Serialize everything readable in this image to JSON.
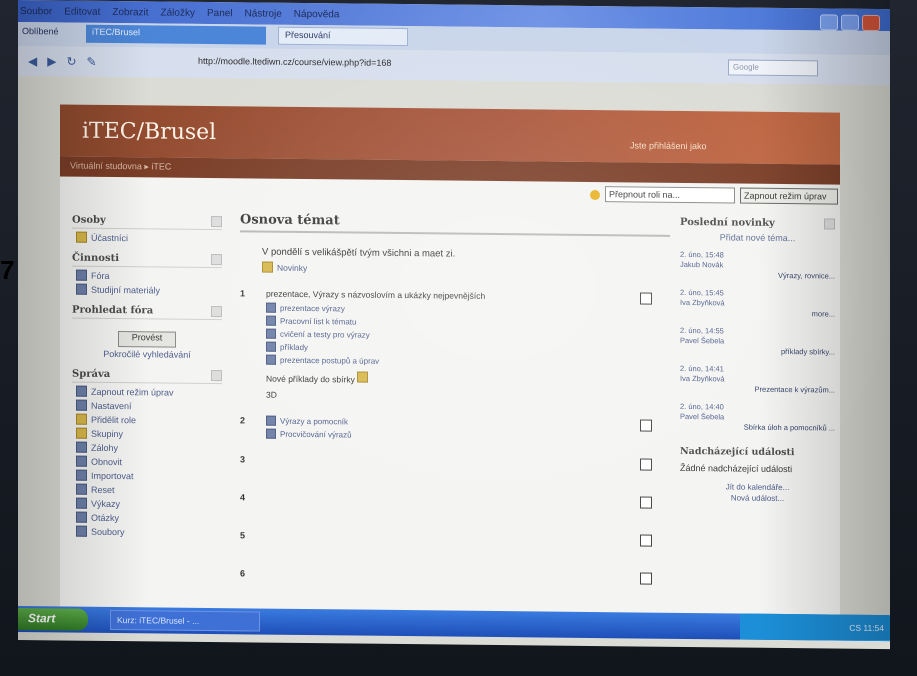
{
  "browser": {
    "menu": [
      "Soubor",
      "Editovat",
      "Zobrazit",
      "Záložky",
      "Panel",
      "Nástroje",
      "Nápověda"
    ],
    "favorites_label": "Oblíbené",
    "tabs": [
      {
        "label": "iTEC/Brusel"
      },
      {
        "label": "Přesouvání"
      }
    ],
    "address": "http://moodle.ltediwn.cz/course/view.php?id=168",
    "search_placeholder": "Google"
  },
  "page": {
    "site_title": "iTEC/Brusel",
    "login_info": "Jste přihlášeni jako",
    "breadcrumb": "Virtuální studovna  ▸  iTEC",
    "jump_select": "Přepnout roli na...",
    "edit_button": "Zapnout režim úprav"
  },
  "left": {
    "people": {
      "title": "Osoby",
      "items": [
        {
          "label": "Účastníci"
        }
      ]
    },
    "activities": {
      "title": "Činnosti",
      "items": [
        {
          "label": "Fóra"
        },
        {
          "label": "Studijní materiály"
        }
      ]
    },
    "search": {
      "title": "Prohledat fóra",
      "button": "Provést",
      "advanced": "Pokročilé vyhledávání"
    },
    "admin": {
      "title": "Správa",
      "items": [
        {
          "label": "Zapnout režim úprav"
        },
        {
          "label": "Nastavení"
        },
        {
          "label": "Přidělit role"
        },
        {
          "label": "Skupiny"
        },
        {
          "label": "Zálohy"
        },
        {
          "label": "Obnovit"
        },
        {
          "label": "Importovat"
        },
        {
          "label": "Reset"
        },
        {
          "label": "Výkazy"
        },
        {
          "label": "Otázky"
        },
        {
          "label": "Soubory"
        }
      ]
    }
  },
  "main": {
    "title": "Osnova témat",
    "intro": "V pondělí s velikášpětí tvým všichni a maet zi.",
    "news_label": "Novinky",
    "topics": [
      {
        "num": "1",
        "heading": "prezentace, Výrazy s názvoslovím a ukázky nejpevnějších",
        "resources": [
          {
            "label": "prezentace výrazy"
          },
          {
            "label": "Pracovní list k tématu"
          },
          {
            "label": "cvičení a testy pro výrazy"
          },
          {
            "label": "příklady"
          },
          {
            "label": "prezentace postupů a úprav"
          }
        ],
        "note": "Nové příklady do sbírky",
        "note2": "3D"
      },
      {
        "num": "2",
        "heading": "",
        "resources": [
          {
            "label": "Výrazy a pomocník"
          },
          {
            "label": "Procvičování výrazů"
          }
        ]
      },
      {
        "num": "3",
        "heading": "",
        "resources": []
      },
      {
        "num": "4",
        "heading": "",
        "resources": []
      },
      {
        "num": "5",
        "heading": "",
        "resources": []
      },
      {
        "num": "6",
        "heading": "",
        "resources": []
      }
    ]
  },
  "right": {
    "latest_title": "Poslední novinky",
    "add_topic": "Přidat nové téma...",
    "posts": [
      {
        "date": "2. úno, 15:48",
        "author": "Jakub Novák",
        "subject": "Výrazy, rovnice..."
      },
      {
        "date": "2. úno, 15:45",
        "author": "Iva Zbyňková",
        "subject": "more..."
      },
      {
        "date": "2. úno, 14:55",
        "author": "Pavel Šebela",
        "subject": "příklady sbírky..."
      },
      {
        "date": "2. úno, 14:41",
        "author": "Iva Zbyňková",
        "subject": "Prezentace k výrazům..."
      },
      {
        "date": "2. úno, 14:40",
        "author": "Pavel Šebela",
        "subject": "Sbírka úloh a pomocníků ..."
      }
    ],
    "events_title": "Nadcházející události",
    "events_none": "Žádné nadcházející události",
    "events_links": [
      "Jít do kalendáře...",
      "Nová událost..."
    ]
  },
  "taskbar": {
    "start": "Start",
    "task": "Kurz: iTEC/Brusel - ...",
    "tray": "CS  11:54"
  },
  "colors": {
    "header": "#a8553a",
    "navbar": "#7a3d26",
    "link": "#4b5b8a"
  }
}
